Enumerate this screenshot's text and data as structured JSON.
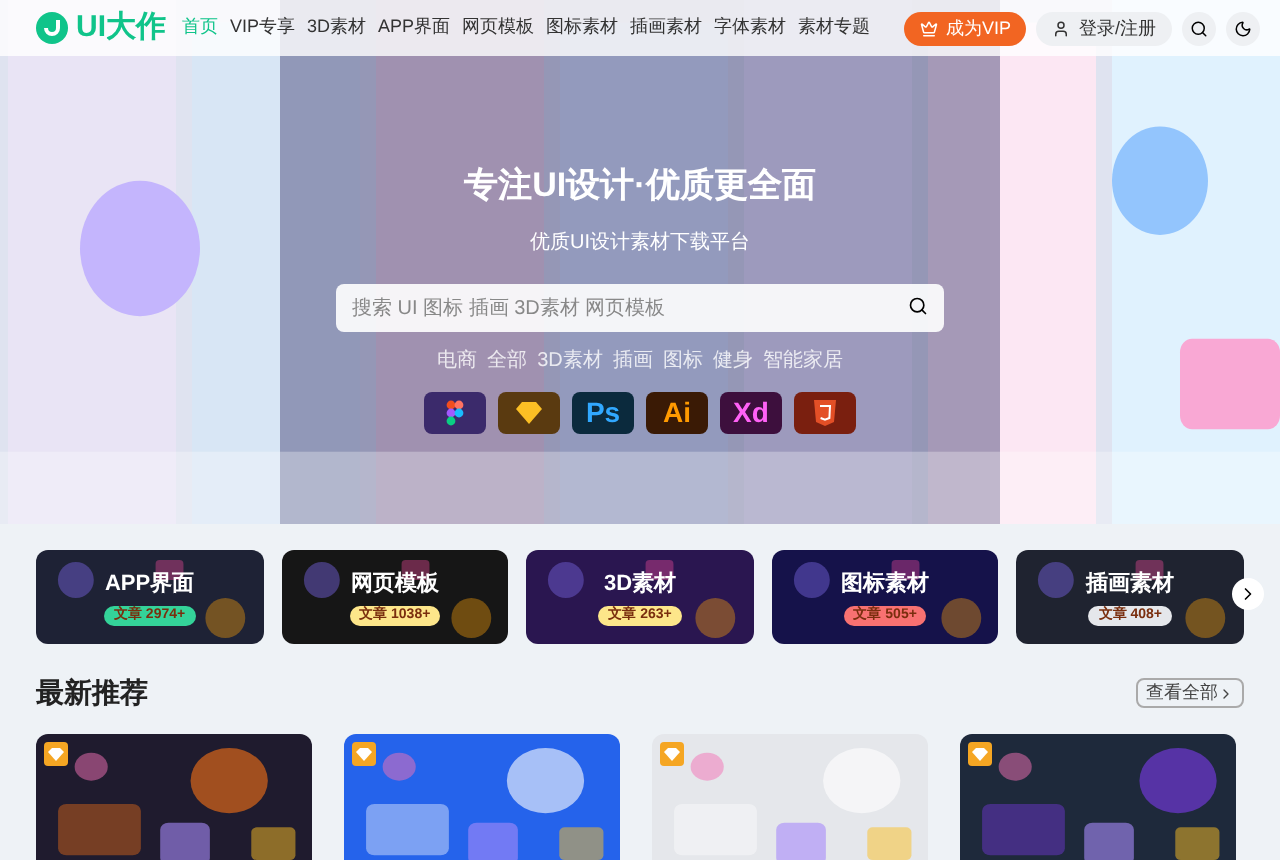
{
  "header": {
    "logo": "UI大作",
    "nav": [
      {
        "label": "首页",
        "selected": true
      },
      {
        "label": "VIP专享",
        "selected": false
      },
      {
        "label": "3D素材",
        "selected": false
      },
      {
        "label": "APP界面",
        "selected": false
      },
      {
        "label": "网页模板",
        "selected": false
      },
      {
        "label": "图标素材",
        "selected": false
      },
      {
        "label": "插画素材",
        "selected": false
      },
      {
        "label": "字体素材",
        "selected": false
      },
      {
        "label": "素材专题",
        "selected": false
      }
    ],
    "vip_button": "成为VIP",
    "login_button": "登录/注册"
  },
  "hero": {
    "title": "专注UI设计·优质更全面",
    "subtitle": "优质UI设计素材下载平台",
    "search": {
      "placeholder": "搜索 UI 图标 插画 3D素材 网页模板"
    },
    "tags": [
      "电商",
      "全部",
      "3D素材",
      "插画",
      "图标",
      "健身",
      "智能家居"
    ],
    "tools": [
      {
        "kind": "figma"
      },
      {
        "kind": "sketch"
      },
      {
        "kind": "ps",
        "label": "Ps"
      },
      {
        "kind": "ai",
        "label": "Ai"
      },
      {
        "kind": "xd",
        "label": "Xd"
      },
      {
        "kind": "html5"
      }
    ]
  },
  "categories": [
    {
      "title": "APP界面",
      "count": "文章 2974+",
      "color": "#34d399"
    },
    {
      "title": "网页模板",
      "count": "文章 1038+",
      "color": "#fde68a"
    },
    {
      "title": "3D素材",
      "count": "文章 263+",
      "color": "#fde68a"
    },
    {
      "title": "图标素材",
      "count": "文章 505+",
      "color": "#f87171"
    },
    {
      "title": "插画素材",
      "count": "文章 408+",
      "color": "#e5e7eb"
    }
  ],
  "latest": {
    "title": "最新推荐",
    "view_all": "查看全部"
  }
}
